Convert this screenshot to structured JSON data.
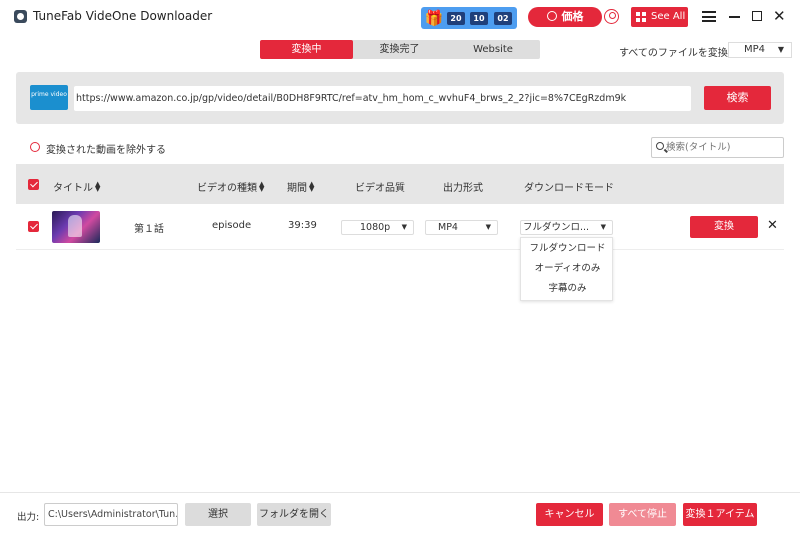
{
  "app": {
    "title": "TuneFab VideOne Downloader"
  },
  "promo": {
    "countdown": [
      "20",
      "10",
      "02"
    ]
  },
  "header": {
    "price_label": "価格",
    "see_all_label": "See All"
  },
  "tabs": [
    {
      "label": "変換中",
      "active": true
    },
    {
      "label": "変換完了",
      "active": false
    },
    {
      "label": "Website",
      "active": false
    }
  ],
  "convert_all": {
    "label": "すべてのファイルを変換：",
    "format": "MP4"
  },
  "url_bar": {
    "logo_text": "prime video",
    "url": "https://www.amazon.co.jp/gp/video/detail/B0DH8F9RTC/ref=atv_hm_hom_c_wvhuF4_brws_2_2?jic=8%7CEgRzdm9k",
    "search_label": "検索"
  },
  "filter": {
    "exclude_label": "変換された動画を除外する",
    "search_placeholder": "検索(タイトル)"
  },
  "table": {
    "columns": {
      "title": "タイトル",
      "type": "ビデオの種類",
      "duration": "期間",
      "quality": "ビデオ品質",
      "format": "出力形式",
      "mode": "ダウンロードモード"
    },
    "rows": [
      {
        "title": "第１話",
        "type": "episode",
        "duration": "39:39",
        "quality": "1080p",
        "format": "MP4",
        "mode": "フルダウンロ...",
        "convert_label": "変換"
      }
    ]
  },
  "mode_dropdown": {
    "options": [
      "フルダウンロード",
      "オーディオのみ",
      "字幕のみ"
    ]
  },
  "footer": {
    "output_label": "出力:",
    "output_path": "C:\\Users\\Administrator\\Tun...",
    "select_label": "選択",
    "open_folder_label": "フォルダを開く",
    "cancel_label": "キャンセル",
    "stop_all_label": "すべて停止",
    "convert_items_label": "変換１アイテム"
  },
  "colors": {
    "accent": "#e4283b",
    "panel": "#e6e6e6"
  }
}
